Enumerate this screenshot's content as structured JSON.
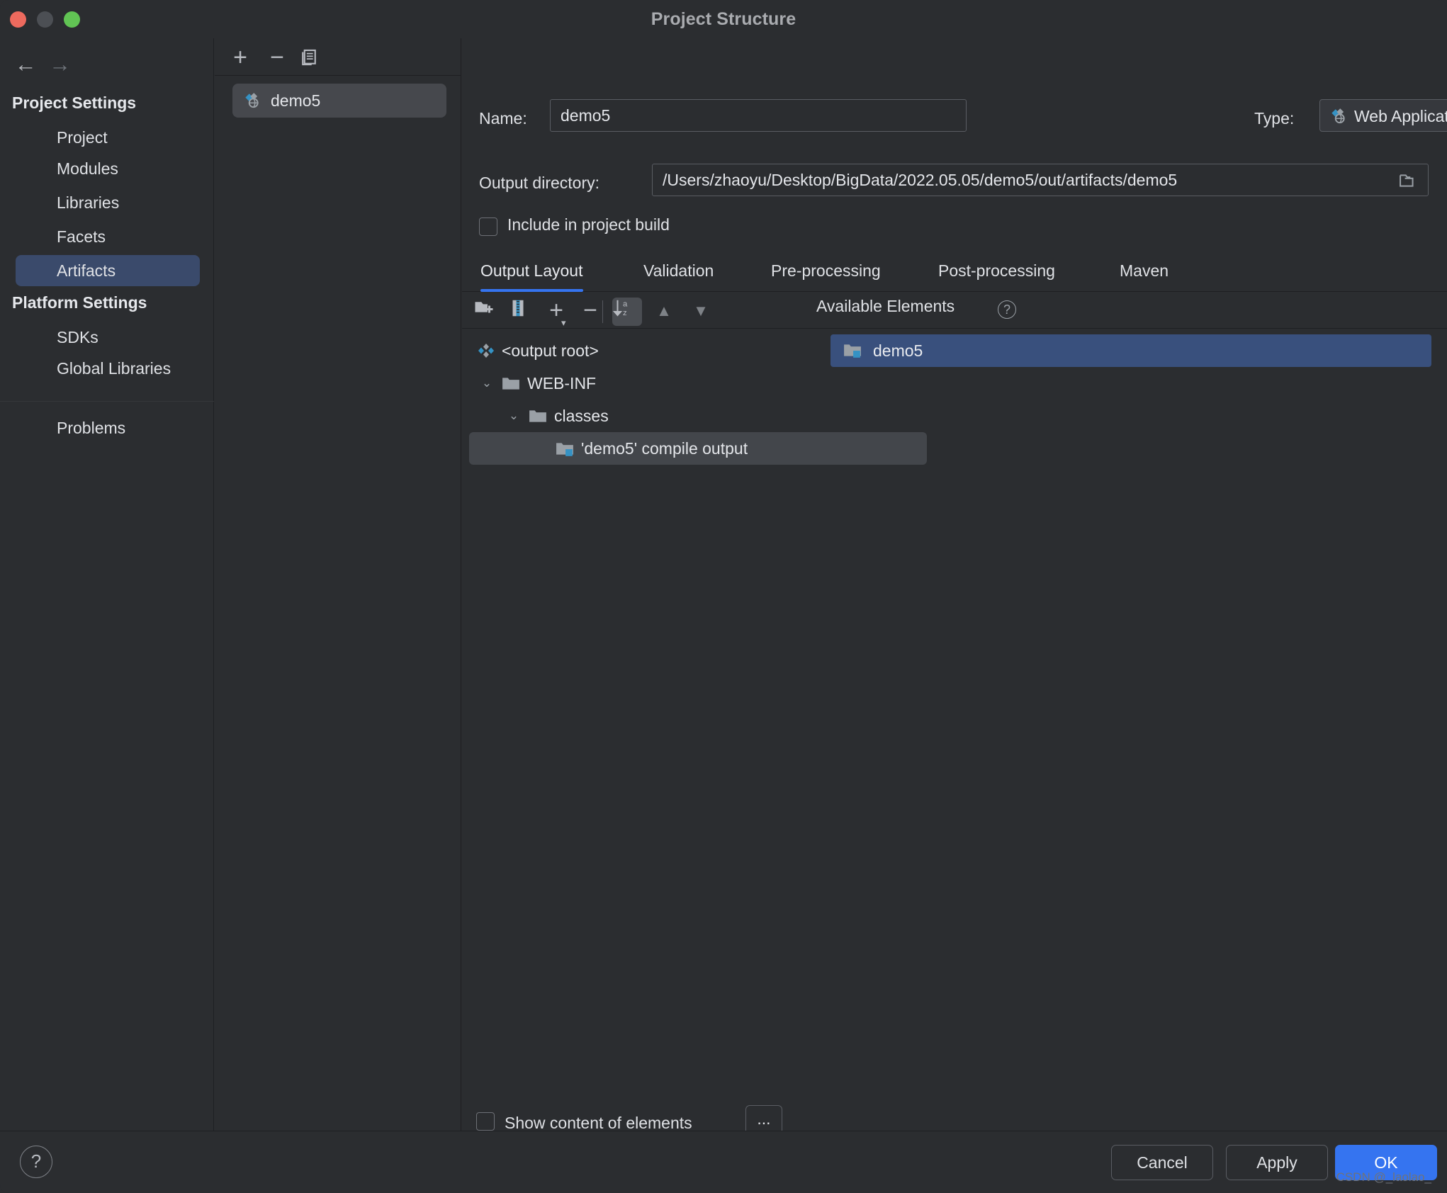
{
  "window": {
    "title": "Project Structure",
    "traffic_lights": [
      "close",
      "minimize",
      "maximize"
    ]
  },
  "colors": {
    "background": "#2b2d30",
    "accent_blue": "#3574f0",
    "selection_blue": "#3a4a6b",
    "available_selection": "#39507d",
    "row_selection_gray": "#43464b",
    "border": "#1e1f22",
    "text": "#dfe1e5",
    "icon_cyan": "#3592c4"
  },
  "nav": {
    "back_label": "←",
    "forward_label": "→",
    "groups": [
      {
        "title": "Project Settings",
        "items": [
          {
            "label": "Project",
            "selected": false
          },
          {
            "label": "Modules",
            "selected": false
          },
          {
            "label": "Libraries",
            "selected": false
          },
          {
            "label": "Facets",
            "selected": false
          },
          {
            "label": "Artifacts",
            "selected": true
          }
        ]
      },
      {
        "title": "Platform Settings",
        "items": [
          {
            "label": "SDKs",
            "selected": false
          },
          {
            "label": "Global Libraries",
            "selected": false
          }
        ]
      }
    ],
    "extra_items": [
      {
        "label": "Problems",
        "selected": false
      }
    ]
  },
  "artifacts_panel": {
    "toolbar": {
      "add_label": "+",
      "remove_label": "−",
      "copy_icon": "copy-icon"
    },
    "items": [
      {
        "label": "demo5",
        "icon": "web-application-icon",
        "selected": true
      }
    ]
  },
  "detail": {
    "name_label": "Name:",
    "name_value": "demo5",
    "type_label": "Type:",
    "type_value": "Web Application: Exploded",
    "type_icon": "web-application-icon",
    "type_chevron": "chevron-down-icon",
    "output_directory_label": "Output directory:",
    "output_directory_value": "/Users/zhaoyu/Desktop/BigData/2022.05.05/demo5/out/artifacts/demo5",
    "browse_icon": "folder-open-icon",
    "include_in_build_label": "Include in project build",
    "include_in_build_checked": false,
    "tabs": [
      {
        "label": "Output Layout",
        "active": true
      },
      {
        "label": "Validation",
        "active": false
      },
      {
        "label": "Pre-processing",
        "active": false
      },
      {
        "label": "Post-processing",
        "active": false
      },
      {
        "label": "Maven",
        "active": false
      }
    ],
    "layout_toolbar": [
      {
        "name": "create-directory-icon",
        "toggled": false
      },
      {
        "name": "create-archive-icon",
        "toggled": false
      },
      {
        "name": "add-icon",
        "toggled": false
      },
      {
        "name": "remove-icon",
        "toggled": false
      },
      {
        "name": "sort-alphabetically-icon",
        "toggled": true
      },
      {
        "name": "move-up-icon",
        "toggled": false
      },
      {
        "name": "move-down-icon",
        "toggled": false
      }
    ],
    "tree": [
      {
        "label": "<output root>",
        "depth": 0,
        "icon": "artifact-root-icon",
        "twisty": "",
        "selected": false
      },
      {
        "label": "WEB-INF",
        "depth": 1,
        "icon": "folder-icon",
        "twisty": "⌄",
        "selected": false
      },
      {
        "label": "classes",
        "depth": 2,
        "icon": "folder-icon",
        "twisty": "⌄",
        "selected": false
      },
      {
        "label": "'demo5' compile output",
        "depth": 3,
        "icon": "module-output-icon",
        "twisty": "",
        "selected": true
      }
    ],
    "available_elements_label": "Available Elements",
    "available_help_icon": "help-icon",
    "available_items": [
      {
        "label": "demo5",
        "icon": "module-output-icon",
        "selected": true
      }
    ],
    "show_content_label": "Show content of elements",
    "show_content_checked": false,
    "show_content_ellipsis": "..."
  },
  "footer": {
    "help_label": "?",
    "cancel_label": "Cancel",
    "apply_label": "Apply",
    "ok_label": "OK"
  },
  "watermark": "CSDN @_laolao_"
}
